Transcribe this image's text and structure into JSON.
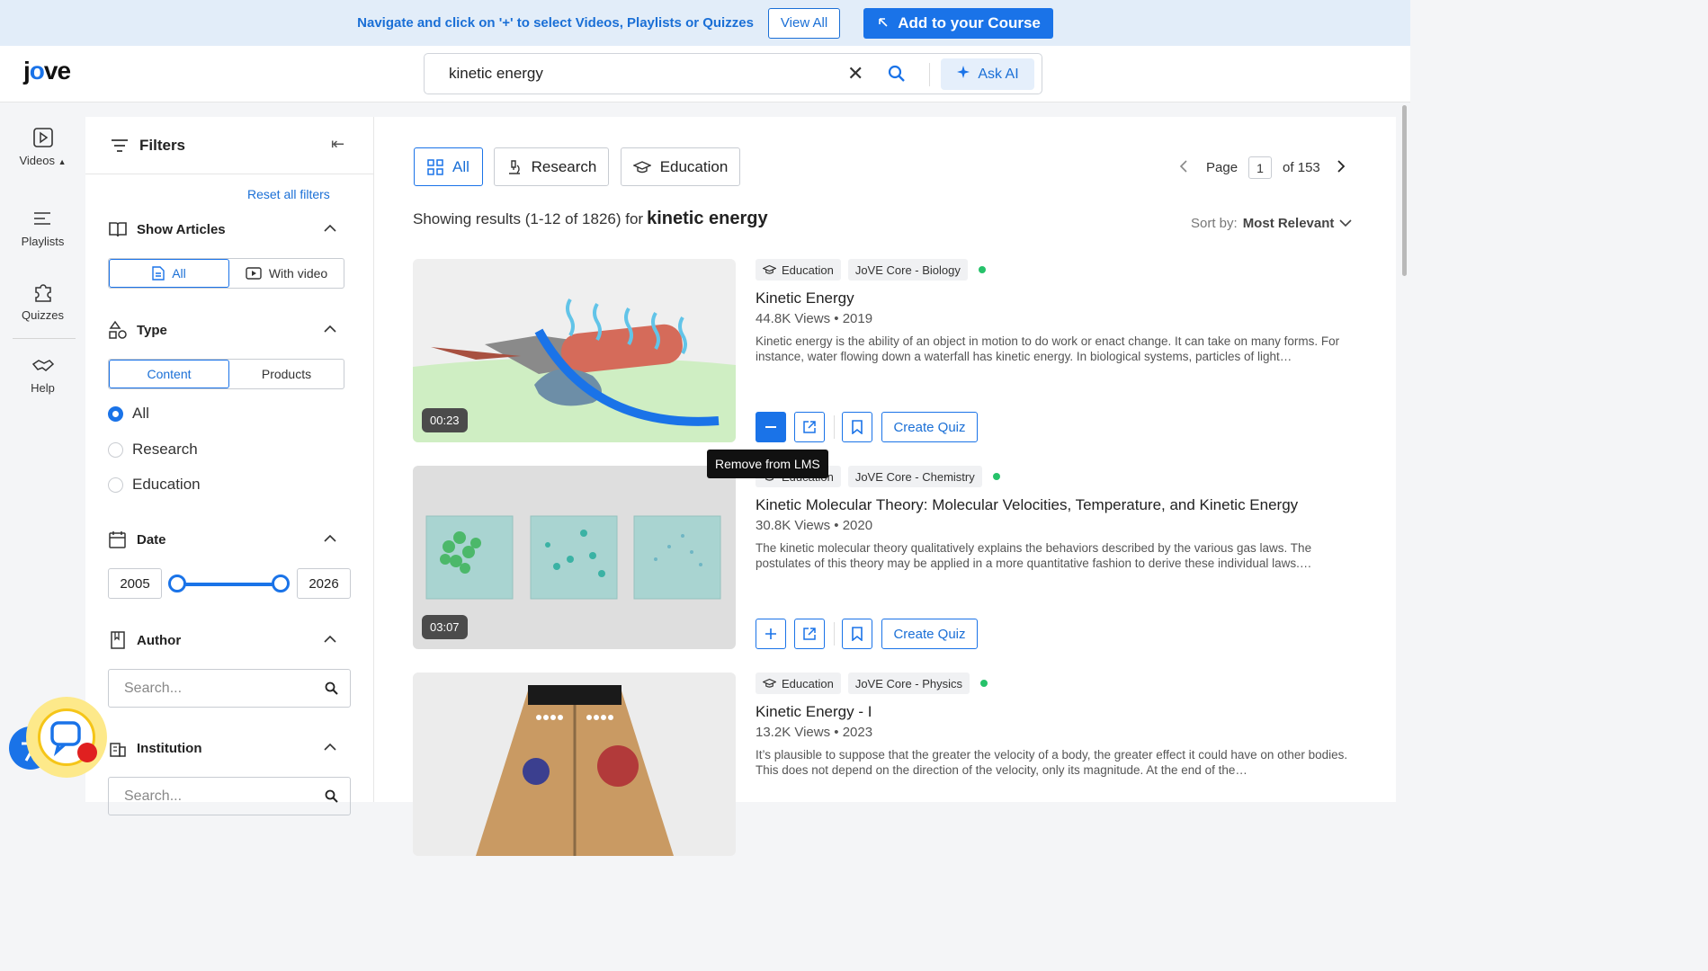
{
  "banner": {
    "message": "Navigate and click on '+' to select Videos, Playlists or Quizzes",
    "view_all": "View All",
    "add_course": "Add to your Course"
  },
  "header": {
    "logo_a": "j",
    "logo_b": "o",
    "logo_c": "ve",
    "search_value": "kinetic energy",
    "ask_ai": "Ask AI"
  },
  "leftnav": {
    "videos": "Videos",
    "playlists": "Playlists",
    "quizzes": "Quizzes",
    "help": "Help"
  },
  "filters": {
    "title": "Filters",
    "reset": "Reset all filters",
    "show_articles": "Show Articles",
    "articles_all": "All",
    "articles_video": "With video",
    "type": "Type",
    "type_content": "Content",
    "type_products": "Products",
    "radio_all": "All",
    "radio_research": "Research",
    "radio_education": "Education",
    "date": "Date",
    "year_from": "2005",
    "year_to": "2026",
    "author": "Author",
    "author_placeholder": "Search...",
    "institution": "Institution",
    "institution_placeholder": "Search..."
  },
  "main": {
    "tab_all": "All",
    "tab_research": "Research",
    "tab_education": "Education",
    "page_label": "Page",
    "page_current": "1",
    "page_total": "of 153",
    "results_text": "Showing results (1-12 of 1826) for",
    "results_keyword": "kinetic energy",
    "sort_label": "Sort by:",
    "sort_value": "Most Relevant"
  },
  "cards": [
    {
      "duration": "00:23",
      "badge_type": "Education",
      "badge_collection": "JoVE Core - Biology",
      "title": "Kinetic Energy",
      "meta": "44.8K Views • 2019",
      "description": "Kinetic energy is the ability of an object in motion to do work or enact change. It can take on many forms. For instance, water flowing down a waterfall has kinetic energy. In biological systems, particles of light…",
      "create_quiz": "Create Quiz"
    },
    {
      "duration": "03:07",
      "badge_type": "Education",
      "badge_collection": "JoVE Core - Chemistry",
      "title": "Kinetic Molecular Theory: Molecular Velocities, Temperature, and Kinetic Energy",
      "meta": "30.8K Views • 2020",
      "description": "The kinetic molecular theory qualitatively explains the behaviors described by the various gas laws. The postulates of this theory may be applied in a more quantitative fashion to derive these individual laws.…",
      "create_quiz": "Create Quiz"
    },
    {
      "duration": "",
      "badge_type": "Education",
      "badge_collection": "JoVE Core - Physics",
      "title": "Kinetic Energy - I",
      "meta": "13.2K Views • 2023",
      "description": "It’s plausible to suppose that the greater the velocity of a body, the greater effect it could have on other bodies. This does not depend on the direction of the velocity, only its magnitude. At the end of the…",
      "create_quiz": "Create Quiz"
    }
  ],
  "tooltip": "Remove from LMS",
  "colors": {
    "accent": "#1a73e8",
    "banner_bg": "#e2edf9",
    "live_dot": "#26c26a"
  }
}
